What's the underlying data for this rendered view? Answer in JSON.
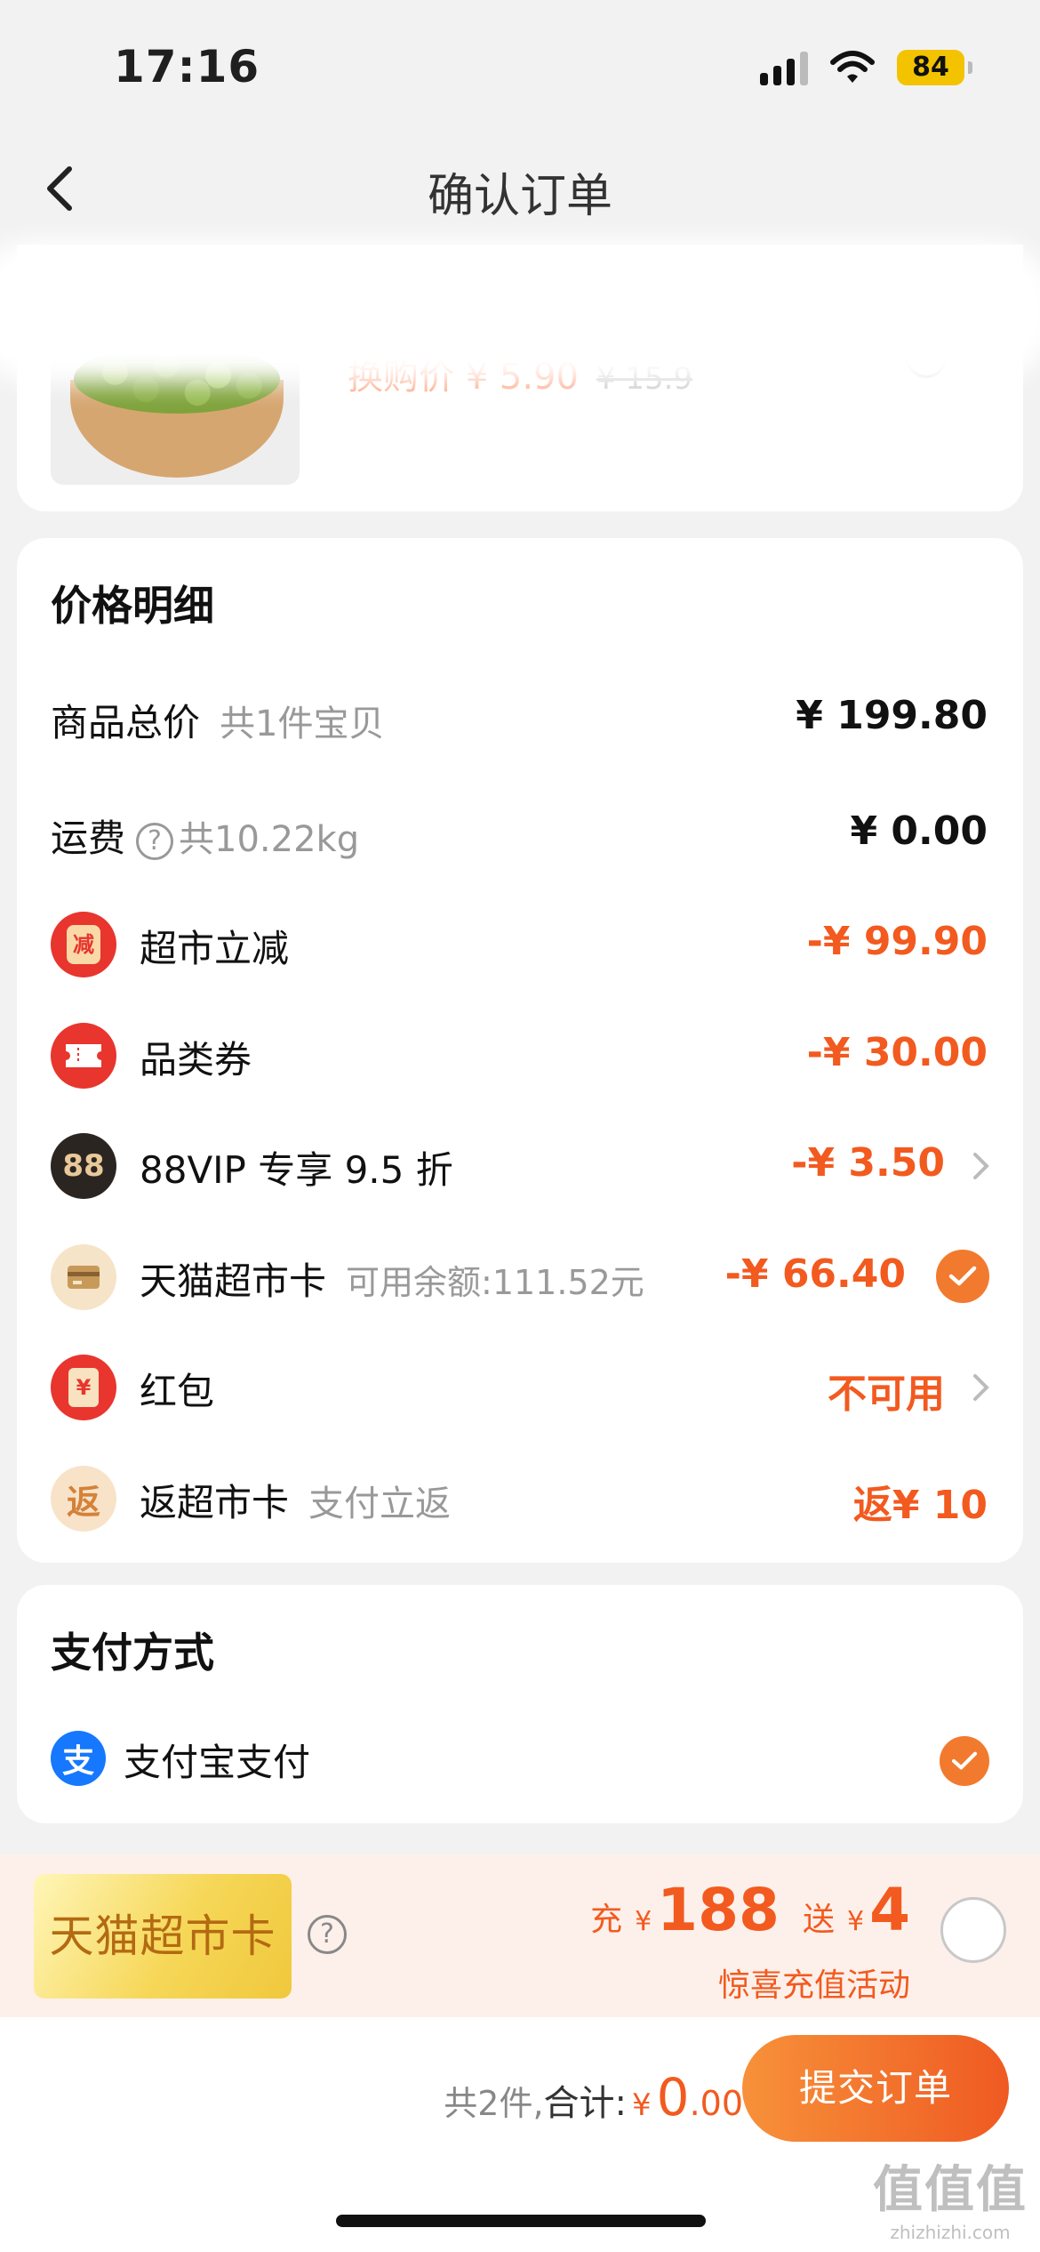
{
  "status_bar": {
    "time": "17:16",
    "battery": "84"
  },
  "nav": {
    "title": "确认订单"
  },
  "product": {
    "price_label": "换购价 ¥ 5.90",
    "original_price": "¥ 15.9"
  },
  "price_detail": {
    "title": "价格明细",
    "goods_total_label": "商品总价",
    "goods_total_sub": "共1件宝贝",
    "goods_total_amount": "¥ 199.80",
    "shipping_label": "运费",
    "shipping_sub": "共10.22kg",
    "shipping_amount": "¥ 0.00",
    "supermarket_discount_label": "超市立减",
    "supermarket_discount_badge": "减",
    "supermarket_discount_amount": "-¥ 99.90",
    "category_coupon_label": "品类券",
    "category_coupon_amount": "-¥ 30.00",
    "vip_label": "88VIP 专享 9.5 折",
    "vip_badge": "88",
    "vip_amount": "-¥ 3.50",
    "tmall_card_label": "天猫超市卡",
    "tmall_card_sub": "可用余额:111.52元",
    "tmall_card_amount": "-¥ 66.40",
    "red_packet_label": "红包",
    "red_packet_badge": "¥",
    "red_packet_status": "不可用",
    "cashback_label": "返超市卡",
    "cashback_badge": "返",
    "cashback_sub": "支付立返",
    "cashback_amount": "返¥ 10"
  },
  "payment": {
    "title": "支付方式",
    "method": "支付宝支付"
  },
  "promo": {
    "card_name": "天猫超市卡",
    "charge_word": "充",
    "yen": "¥",
    "charge_amount": "188",
    "gift_word": "送",
    "gift_amount": "4",
    "subtitle": "惊喜充值活动"
  },
  "bottom": {
    "count": "共2件,",
    "total_label": "合计:",
    "yen": "¥",
    "total_int": "0",
    "total_dec": ".00",
    "submit": "提交订单"
  },
  "watermark": {
    "main": "值值值",
    "sub": "zhizhizhi.com"
  },
  "colors": {
    "accent": "#f25a1f",
    "check": "#f27a2e",
    "alipay": "#1677ff",
    "badge_red": "#e8352e"
  }
}
